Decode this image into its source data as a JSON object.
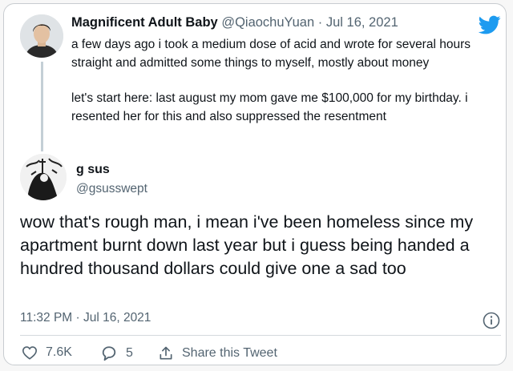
{
  "quoted": {
    "name": "Magnificent Adult Baby",
    "handle": "@QiaochuYuan",
    "separator": "·",
    "date": "Jul 16, 2021",
    "text_p1": "a few days ago i took a medium dose of acid and wrote for several hours straight and admitted some things to myself, mostly about money",
    "text_p2": "let's start here: last august my mom gave me $100,000 for my birthday. i resented her for this and also suppressed the resentment"
  },
  "reply": {
    "name": "g sus",
    "handle": "@gsusswept",
    "text": "wow that's rough man, i mean i've been homeless since my apartment burnt down last year but i guess being handed a hundred thousand dollars could give one a sad too",
    "timestamp": "11:32 PM · Jul 16, 2021"
  },
  "actions": {
    "likes": "7.6K",
    "replies": "5",
    "share_label": "Share this Tweet"
  },
  "colors": {
    "twitter_blue": "#1d9bf0",
    "muted_text": "#536471",
    "thread_line": "#c4cfd6"
  },
  "icons": [
    "twitter-bird-icon",
    "info-icon",
    "heart-icon",
    "reply-icon",
    "share-icon"
  ]
}
